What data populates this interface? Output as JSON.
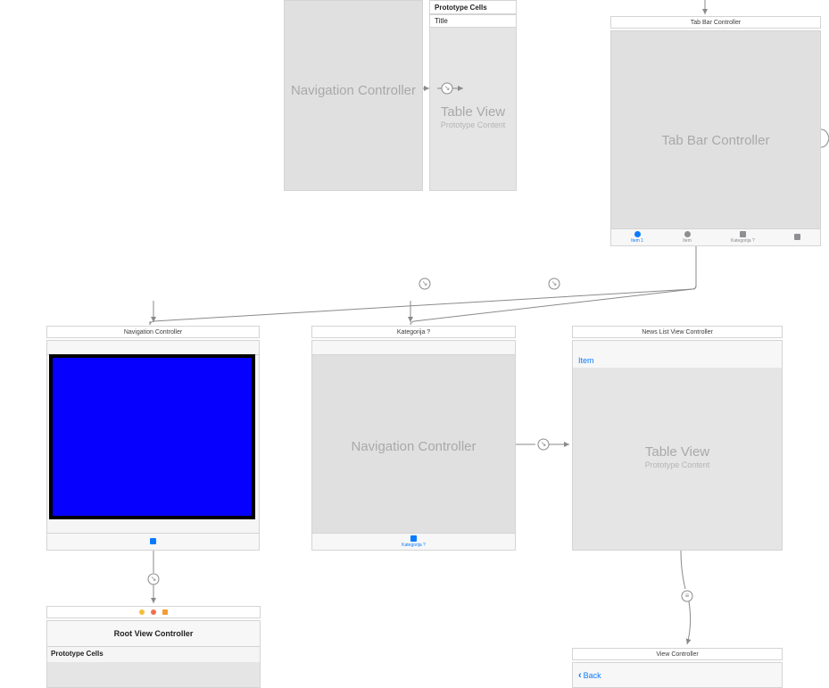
{
  "top": {
    "navController": {
      "label": "Navigation Controller"
    },
    "tableView": {
      "prototypeHeader": "Prototype Cells",
      "titleCell": "Title",
      "label": "Table View",
      "subLabel": "Prototype Content"
    },
    "tabBar": {
      "title": "Tab Bar Controller",
      "label": "Tab Bar Controller",
      "items": [
        {
          "label": "Item 1",
          "active": true
        },
        {
          "label": "Item",
          "active": false
        },
        {
          "label": "Kategorija ?",
          "active": false
        },
        {
          "label": "",
          "active": false
        }
      ]
    }
  },
  "middle": {
    "navController": {
      "title": "Navigation Controller",
      "bottomItemLabel": ""
    },
    "kategorija": {
      "title": "Kategorija ?",
      "label": "Navigation Controller",
      "bottomItemLabel": "Kategorija ?"
    },
    "newsList": {
      "title": "News List View Controller",
      "itemLabel": "Item",
      "label": "Table View",
      "subLabel": "Prototype Content"
    }
  },
  "bottom": {
    "rootView": {
      "title": "Root View Controller",
      "section": "Prototype Cells"
    },
    "viewController": {
      "title": "View Controller",
      "back": "Back"
    }
  }
}
